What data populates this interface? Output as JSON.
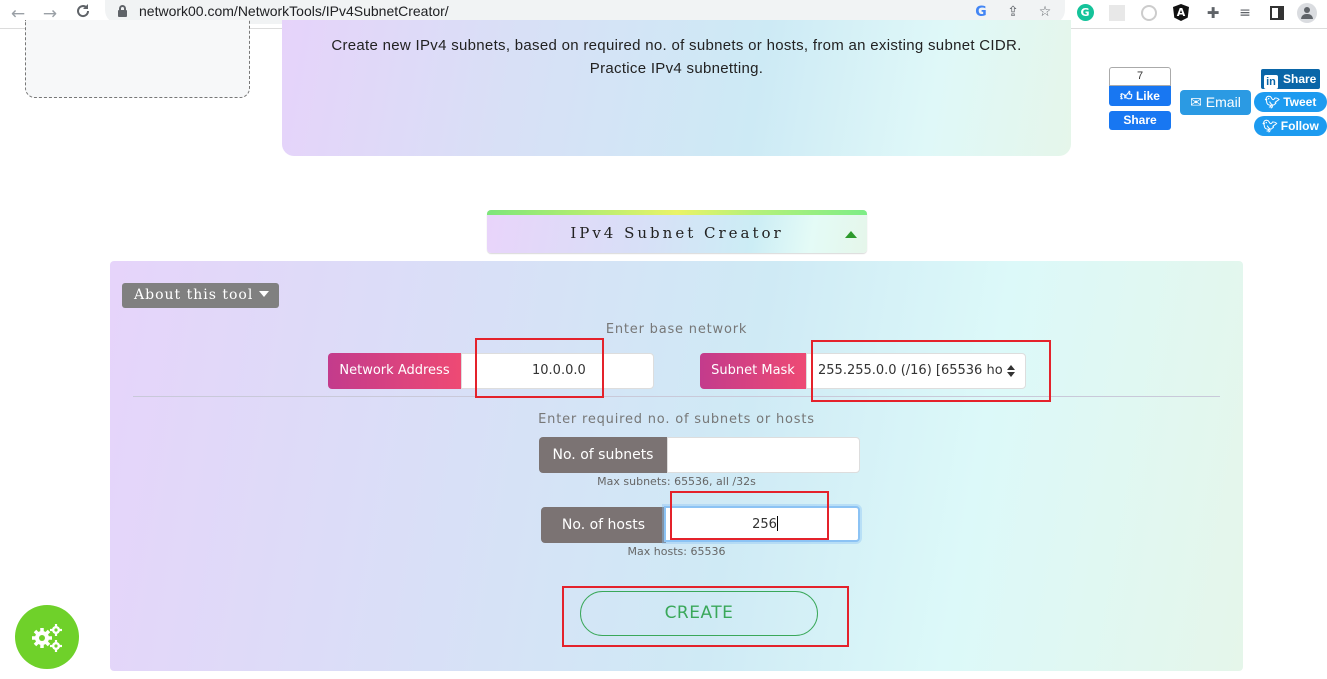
{
  "browser": {
    "url": "network00.com/NetworkTools/IPv4SubnetCreator/",
    "nav": {
      "back_icon": "←",
      "forward_icon": "→",
      "reload_icon": "C"
    },
    "extensions": [
      "google-icon",
      "share-icon",
      "bookmark-star-icon",
      "grammarly-icon",
      "react-devtools-icon",
      "ionic-icon",
      "angular-icon",
      "extensions-puzzle-icon",
      "media-control-icon",
      "side-panel-icon",
      "profile-icon"
    ]
  },
  "hero": {
    "description": "Create new IPv4 subnets, based on required no. of subnets or hosts, from an existing subnet CIDR. Practice IPv4 subnetting."
  },
  "social": {
    "fb_count": "7",
    "fb_like": "Like",
    "fb_share": "Share",
    "email": "Email",
    "linkedin_share": "Share",
    "tweet": "Tweet",
    "follow": "Follow"
  },
  "tool": {
    "title": "IPv4 Subnet Creator",
    "about_label": "About this tool",
    "base_network_label": "Enter base network",
    "network_address_label": "Network Address",
    "network_address_value": "10.0.0.0",
    "subnet_mask_label": "Subnet Mask",
    "subnet_mask_selected": "255.255.0.0 (/16) [65536 ho",
    "required_label": "Enter required no. of subnets or hosts",
    "subnets_label": "No. of subnets",
    "subnets_value": "",
    "subnets_hint": "Max subnets: 65536, all /32s",
    "hosts_label": "No. of hosts",
    "hosts_value": "256",
    "hosts_hint": "Max hosts: 65536",
    "create_label": "CREATE"
  },
  "colors": {
    "accent_pink": "#e8437a",
    "label_gray": "#7b7373",
    "create_green": "#3aa85a",
    "highlight_red": "#e4222b",
    "fab_green": "#6fd12a"
  }
}
